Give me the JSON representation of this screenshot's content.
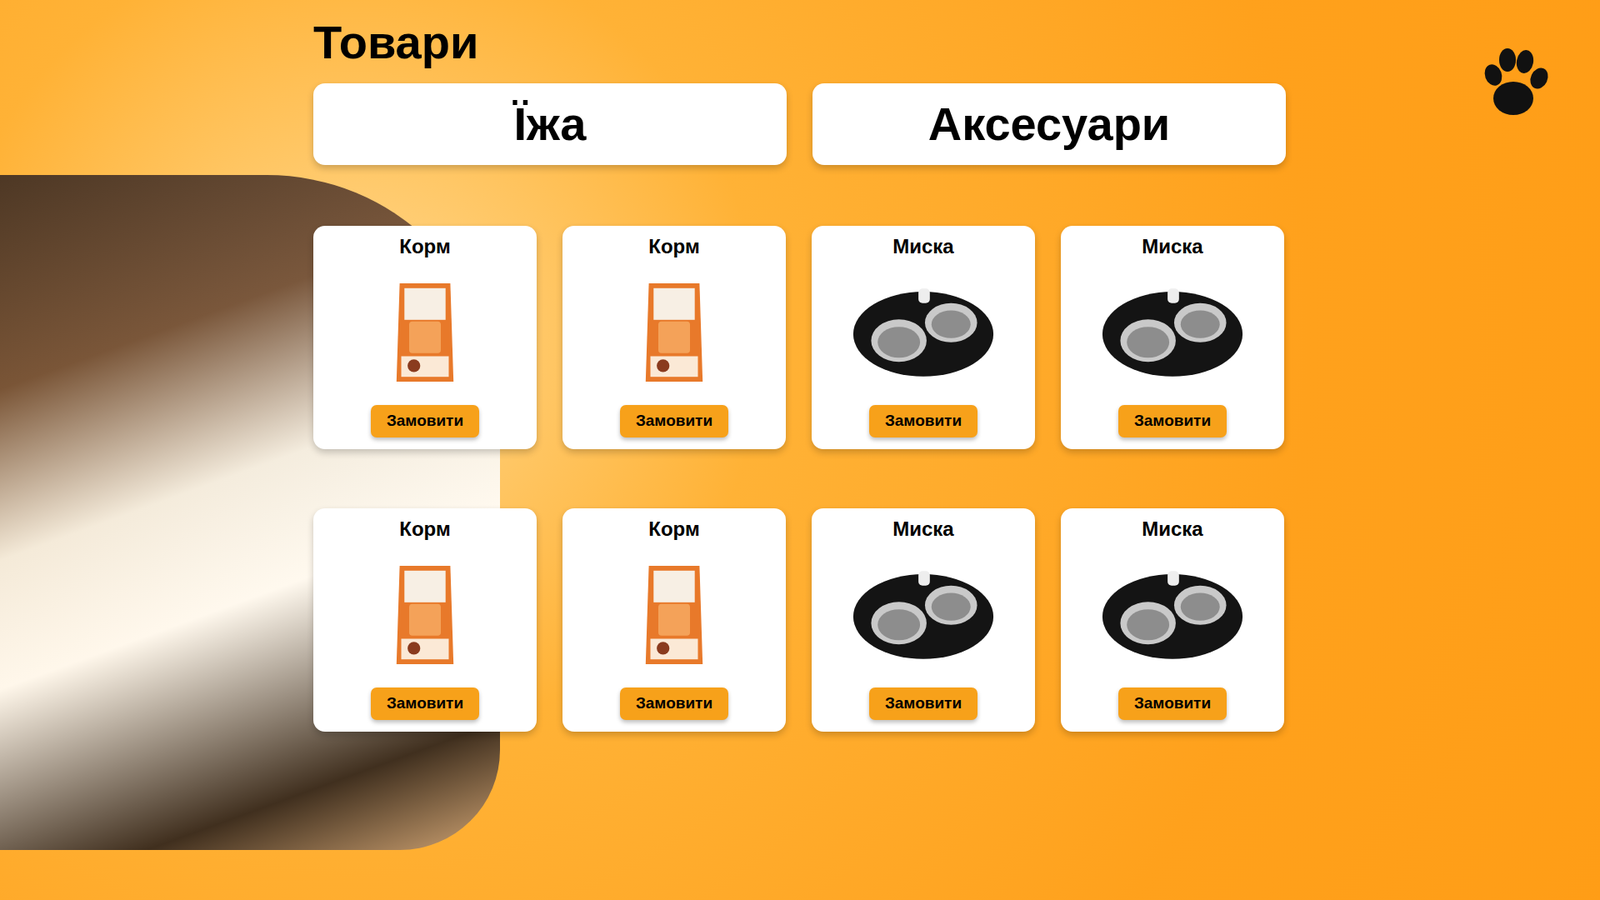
{
  "page": {
    "title": "Товари"
  },
  "categories": [
    {
      "label": "Їжа"
    },
    {
      "label": "Аксесуари"
    }
  ],
  "products": [
    {
      "name": "Корм",
      "kind": "food",
      "button": "Замовити"
    },
    {
      "name": "Корм",
      "kind": "food",
      "button": "Замовити"
    },
    {
      "name": "Миска",
      "kind": "bowl",
      "button": "Замовити"
    },
    {
      "name": "Миска",
      "kind": "bowl",
      "button": "Замовити"
    },
    {
      "name": "Корм",
      "kind": "food",
      "button": "Замовити"
    },
    {
      "name": "Корм",
      "kind": "food",
      "button": "Замовити"
    },
    {
      "name": "Миска",
      "kind": "bowl",
      "button": "Замовити"
    },
    {
      "name": "Миска",
      "kind": "bowl",
      "button": "Замовити"
    }
  ]
}
